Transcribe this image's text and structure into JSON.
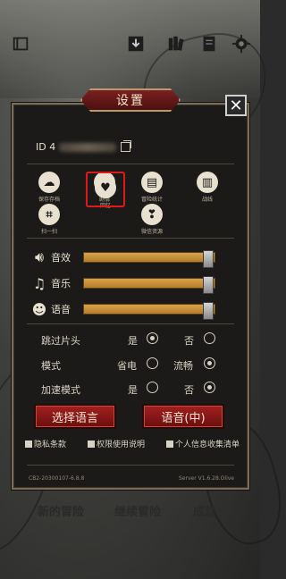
{
  "dialog": {
    "title": "设置",
    "close_label": "✕",
    "id_prefix": "ID 4"
  },
  "features": [
    {
      "label": "保存存档",
      "icon": "cloud-save-icon"
    },
    {
      "label": "剧情",
      "icon": "story-icon"
    },
    {
      "label": "冒险统计",
      "icon": "stats-icon"
    },
    {
      "label": "战线",
      "icon": "battle-line-icon"
    },
    {
      "label": "扫一扫",
      "icon": "scan-icon"
    },
    {
      "label": "回忆",
      "icon": "broken-heart-icon"
    },
    {
      "label": "微信资源",
      "icon": "resource-icon"
    }
  ],
  "audio": {
    "sfx_label": "音效",
    "music_label": "音乐",
    "voice_label": "语音",
    "sfx_level": 0.95,
    "music_level": 0.95,
    "voice_level": 0.95
  },
  "options": {
    "skip_intro": {
      "label": "跳过片头",
      "yes": "是",
      "no": "否",
      "selected": "是"
    },
    "mode": {
      "label": "模式",
      "a": "省电",
      "b": "流畅",
      "selected": "流畅"
    },
    "speed_mode": {
      "label": "加速模式",
      "yes": "是",
      "no": "否",
      "selected": "否"
    }
  },
  "buttons": {
    "language": "选择语言",
    "voice": "语音(中)"
  },
  "links": {
    "privacy": "隐私条款",
    "permissions": "权限使用说明",
    "personal_info": "个人信息收集清单"
  },
  "version": {
    "left": "CB2-20300107-6.8.8",
    "right": "Server V1.6.28.Olive"
  },
  "menu": {
    "new_adventure": "新的冒险",
    "continue_adventure": "继续冒险",
    "achievements": "成就"
  },
  "colors": {
    "highlight": "#e01a1a",
    "slider_fill": "#c8922f",
    "button_red": "#8c1818"
  }
}
